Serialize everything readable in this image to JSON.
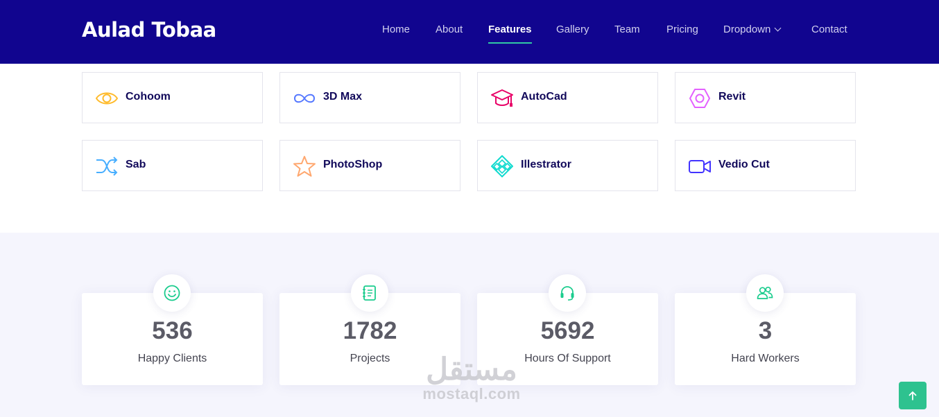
{
  "header": {
    "logo": "Aulad Tobaa",
    "nav": [
      {
        "label": "Home"
      },
      {
        "label": "About"
      },
      {
        "label": "Features",
        "active": true
      },
      {
        "label": "Gallery"
      },
      {
        "label": "Team"
      },
      {
        "label": "Pricing"
      },
      {
        "label": "Dropdown",
        "icon": "chevron-down-icon"
      },
      {
        "label": "Contact"
      }
    ]
  },
  "features": [
    {
      "label": "Cohoom",
      "icon": "eye-icon",
      "color": "#ffbb2c"
    },
    {
      "label": "3D Max",
      "icon": "infinity-icon",
      "color": "#5578ff"
    },
    {
      "label": "AutoCad",
      "icon": "graduation-cap-icon",
      "color": "#e80368"
    },
    {
      "label": "Revit",
      "icon": "hexagon-icon",
      "color": "#e361ff"
    },
    {
      "label": "Sab",
      "icon": "shuffle-icon",
      "color": "#47aeff"
    },
    {
      "label": "PhotoShop",
      "icon": "star-icon",
      "color": "#ffa76e"
    },
    {
      "label": "Illestrator",
      "icon": "diamond-grid-icon",
      "color": "#11dbcf"
    },
    {
      "label": "Vedio Cut",
      "icon": "video-camera-icon",
      "color": "#4233ff"
    }
  ],
  "counts": [
    {
      "value": "536",
      "label": "Happy Clients",
      "icon": "smile-icon"
    },
    {
      "value": "1782",
      "label": "Projects",
      "icon": "journal-icon"
    },
    {
      "value": "5692",
      "label": "Hours Of Support",
      "icon": "headset-icon"
    },
    {
      "value": "3",
      "label": "Hard Workers",
      "icon": "people-icon"
    }
  ],
  "count_icon_color": "#1acc8d",
  "watermark": {
    "arabic": "مستقل",
    "latin": "mostaql.com"
  },
  "back_to_top": {
    "icon": "arrow-up-icon",
    "color": "#2ec28f"
  }
}
